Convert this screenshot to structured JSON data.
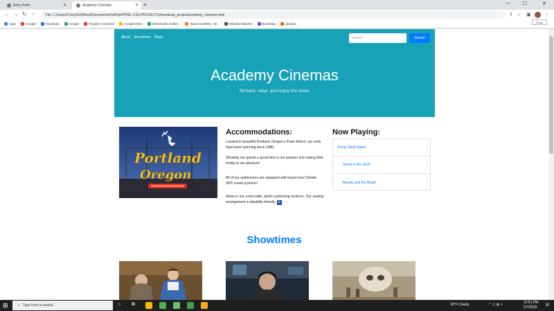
{
  "browser": {
    "tabs": [
      {
        "title": "Entry Point"
      },
      {
        "title": "Academy Cinemas"
      }
    ],
    "address": "File  C:/Users/Corey%20Reed/Documents/GitHub/HTML-CSS-PROJECTS/bootstrap_project/academy_cinemas.html",
    "tooltip": "Close",
    "bookmarks": [
      {
        "label": "Apps",
        "color": "#4285f4"
      },
      {
        "label": "Google",
        "color": "#ea4335"
      },
      {
        "label": "Facebook",
        "color": "#1877f2"
      },
      {
        "label": "Google",
        "color": "#34a853"
      },
      {
        "label": "Youtube Converter",
        "color": "#e53935"
      },
      {
        "label": "Google Drive",
        "color": "#fbbc04"
      },
      {
        "label": "W3Schools Online...",
        "color": "#04aa6d"
      },
      {
        "label": "Stack Overflow - W...",
        "color": "#f48024"
      },
      {
        "label": "Website Watcher",
        "color": "#555555"
      },
      {
        "label": "Bootstrap",
        "color": "#7952b3"
      },
      {
        "label": "Javadoc",
        "color": "#e76f00"
      }
    ]
  },
  "site": {
    "nav": [
      "About",
      "Showtimes",
      "Deals"
    ],
    "search_placeholder": "Search",
    "search_button": "Search",
    "title": "Academy Cinemas",
    "subtitle": "Sit back, relax, and enjoy the show.",
    "accommodations": {
      "heading": "Accommodations:",
      "paragraphs": [
        "Located in beautiful Portland, Oregon's Pearl district, our reels have been spinning since 1988.",
        "Showing our guests a great time is our passion and seeing their smiles is our pleasure!",
        "All of our auditoriums are equipped with brand new Christie 3D® sound systems!",
        "Relax in our, extra-wide, plush-cushioning recliners. Our seating arrangement is disability friendly."
      ]
    },
    "now_playing": {
      "heading": "Now Playing:",
      "items": [
        "Kong: Skull Island",
        "Ghost in the Shell",
        "Beauty and the Beast"
      ]
    },
    "showtimes_heading": "Showtimes"
  },
  "taskbar": {
    "search_placeholder": "Type here to search",
    "weather": "32°F  Cloudy",
    "time": "12:51 PM",
    "date": "2/7/2020"
  },
  "colors": {
    "jumbotron": "#17a2b8",
    "link": "#007bff"
  }
}
